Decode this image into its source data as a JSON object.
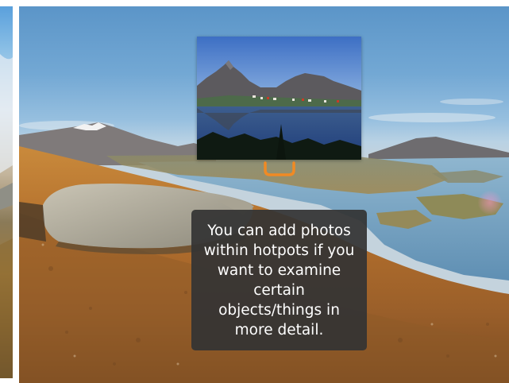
{
  "scene": {
    "left_panorama": {
      "icon": "panorama-preview"
    },
    "main_panorama": {
      "icon": "panorama-view"
    },
    "hotspot": {
      "icon": "hotspot-marker-icon",
      "accent_color": "#f08a24",
      "photo": {
        "icon": "lake-mountain-photo"
      }
    },
    "tooltip": {
      "text": "You can add photos\nwithin hotpots if you\nwant to examine\ncertain\nobjects/things in\nmore detail."
    }
  }
}
